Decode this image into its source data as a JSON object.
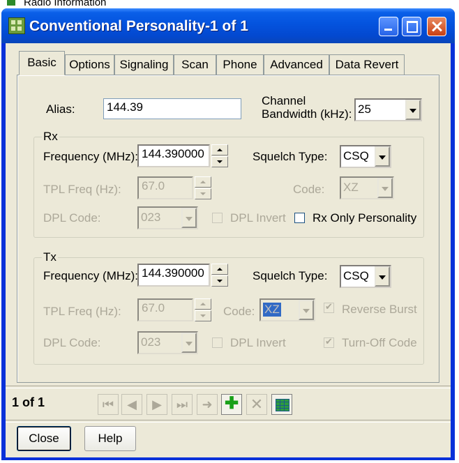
{
  "background_window": {
    "title": "Radio Information"
  },
  "window": {
    "title": "Conventional Personality-1 of 1",
    "minimize_label": "",
    "maximize_label": "",
    "close_label": ""
  },
  "tabs": [
    {
      "label": "Basic",
      "selected": true
    },
    {
      "label": "Options"
    },
    {
      "label": "Signaling"
    },
    {
      "label": "Scan"
    },
    {
      "label": "Phone"
    },
    {
      "label": "Advanced"
    },
    {
      "label": "Data Revert"
    }
  ],
  "alias": {
    "label": "Alias:",
    "value": "144.39"
  },
  "bandwidth": {
    "label_line1": "Channel",
    "label_line2": "Bandwidth (kHz):",
    "value": "25"
  },
  "rx": {
    "group_title": "Rx",
    "frequency_label": "Frequency (MHz):",
    "frequency_value": "144.390000",
    "squelch_label": "Squelch Type:",
    "squelch_value": "CSQ",
    "tpl_label": "TPL Freq (Hz):",
    "tpl_value": "67.0",
    "code_label": "Code:",
    "code_value": "XZ",
    "dpl_label": "DPL Code:",
    "dpl_value": "023",
    "dpl_invert_label": "DPL Invert",
    "rx_only_label": "Rx Only Personality"
  },
  "tx": {
    "group_title": "Tx",
    "frequency_label": "Frequency (MHz):",
    "frequency_value": "144.390000",
    "squelch_label": "Squelch Type:",
    "squelch_value": "CSQ",
    "tpl_label": "TPL Freq (Hz):",
    "tpl_value": "67.0",
    "code_label": "Code:",
    "code_value": "XZ",
    "reverse_burst_label": "Reverse Burst",
    "dpl_label": "DPL Code:",
    "dpl_value": "023",
    "dpl_invert_label": "DPL Invert",
    "turn_off_label": "Turn-Off Code"
  },
  "navigator": {
    "record_text": "1 of 1",
    "icons": [
      "first-record-icon",
      "previous-record-icon",
      "next-record-icon",
      "last-record-icon",
      "goto-arrow-icon",
      "add-record-icon",
      "delete-record-icon",
      "grid-view-icon"
    ]
  },
  "buttons": {
    "close_label": "Close",
    "help_label": "Help"
  },
  "colors": {
    "title_bar": "#0a5fe8",
    "dialog_bg": "#ece9d8",
    "disabled_text": "#aca899",
    "add_icon": "#18a018"
  }
}
